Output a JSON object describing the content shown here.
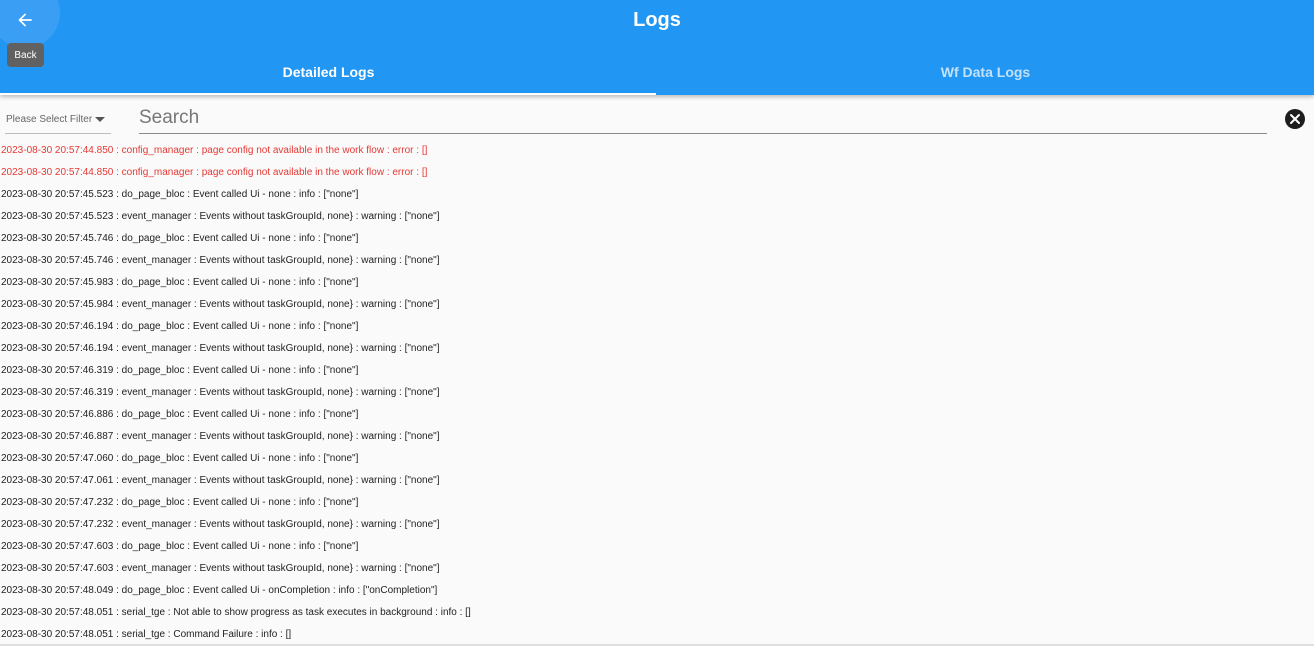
{
  "header": {
    "title": "Logs",
    "back_tooltip": "Back",
    "back_icon": "arrow-left-icon"
  },
  "tabs": [
    {
      "label": "Detailed Logs",
      "active": true
    },
    {
      "label": "Wf Data Logs",
      "active": false
    }
  ],
  "filter": {
    "placeholder": "Please Select Filter"
  },
  "search": {
    "placeholder": "Search",
    "value": ""
  },
  "colors": {
    "primary": "#2196f3",
    "error": "#e53935",
    "text": "#222222"
  },
  "logs": [
    {
      "text": "2023-08-30 20:57:44.850 : config_manager : page config not available in the work flow : error : []",
      "level": "error"
    },
    {
      "text": "2023-08-30 20:57:44.850 : config_manager : page config not available in the work flow : error : []",
      "level": "error"
    },
    {
      "text": "2023-08-30 20:57:45.523 : do_page_bloc : Event called Ui - none : info : [\"none\"]",
      "level": "info"
    },
    {
      "text": "2023-08-30 20:57:45.523 : event_manager : Events without taskGroupId, none} : warning : [\"none\"]",
      "level": "warning"
    },
    {
      "text": "2023-08-30 20:57:45.746 : do_page_bloc : Event called Ui - none : info : [\"none\"]",
      "level": "info"
    },
    {
      "text": "2023-08-30 20:57:45.746 : event_manager : Events without taskGroupId, none} : warning : [\"none\"]",
      "level": "warning"
    },
    {
      "text": "2023-08-30 20:57:45.983 : do_page_bloc : Event called Ui - none : info : [\"none\"]",
      "level": "info"
    },
    {
      "text": "2023-08-30 20:57:45.984 : event_manager : Events without taskGroupId, none} : warning : [\"none\"]",
      "level": "warning"
    },
    {
      "text": "2023-08-30 20:57:46.194 : do_page_bloc : Event called Ui - none : info : [\"none\"]",
      "level": "info"
    },
    {
      "text": "2023-08-30 20:57:46.194 : event_manager : Events without taskGroupId, none} : warning : [\"none\"]",
      "level": "warning"
    },
    {
      "text": "2023-08-30 20:57:46.319 : do_page_bloc : Event called Ui - none : info : [\"none\"]",
      "level": "info"
    },
    {
      "text": "2023-08-30 20:57:46.319 : event_manager : Events without taskGroupId, none} : warning : [\"none\"]",
      "level": "warning"
    },
    {
      "text": "2023-08-30 20:57:46.886 : do_page_bloc : Event called Ui - none : info : [\"none\"]",
      "level": "info"
    },
    {
      "text": "2023-08-30 20:57:46.887 : event_manager : Events without taskGroupId, none} : warning : [\"none\"]",
      "level": "warning"
    },
    {
      "text": "2023-08-30 20:57:47.060 : do_page_bloc : Event called Ui - none : info : [\"none\"]",
      "level": "info"
    },
    {
      "text": "2023-08-30 20:57:47.061 : event_manager : Events without taskGroupId, none} : warning : [\"none\"]",
      "level": "warning"
    },
    {
      "text": "2023-08-30 20:57:47.232 : do_page_bloc : Event called Ui - none : info : [\"none\"]",
      "level": "info"
    },
    {
      "text": "2023-08-30 20:57:47.232 : event_manager : Events without taskGroupId, none} : warning : [\"none\"]",
      "level": "warning"
    },
    {
      "text": "2023-08-30 20:57:47.603 : do_page_bloc : Event called Ui - none : info : [\"none\"]",
      "level": "info"
    },
    {
      "text": "2023-08-30 20:57:47.603 : event_manager : Events without taskGroupId, none} : warning : [\"none\"]",
      "level": "warning"
    },
    {
      "text": "2023-08-30 20:57:48.049 : do_page_bloc : Event called Ui - onCompletion : info : [\"onCompletion\"]",
      "level": "info"
    },
    {
      "text": "2023-08-30 20:57:48.051 : serial_tge : Not able to show progress as task executes in background : info : []",
      "level": "info"
    },
    {
      "text": "2023-08-30 20:57:48.051 : serial_tge : Command Failure : info : []",
      "level": "info"
    }
  ]
}
